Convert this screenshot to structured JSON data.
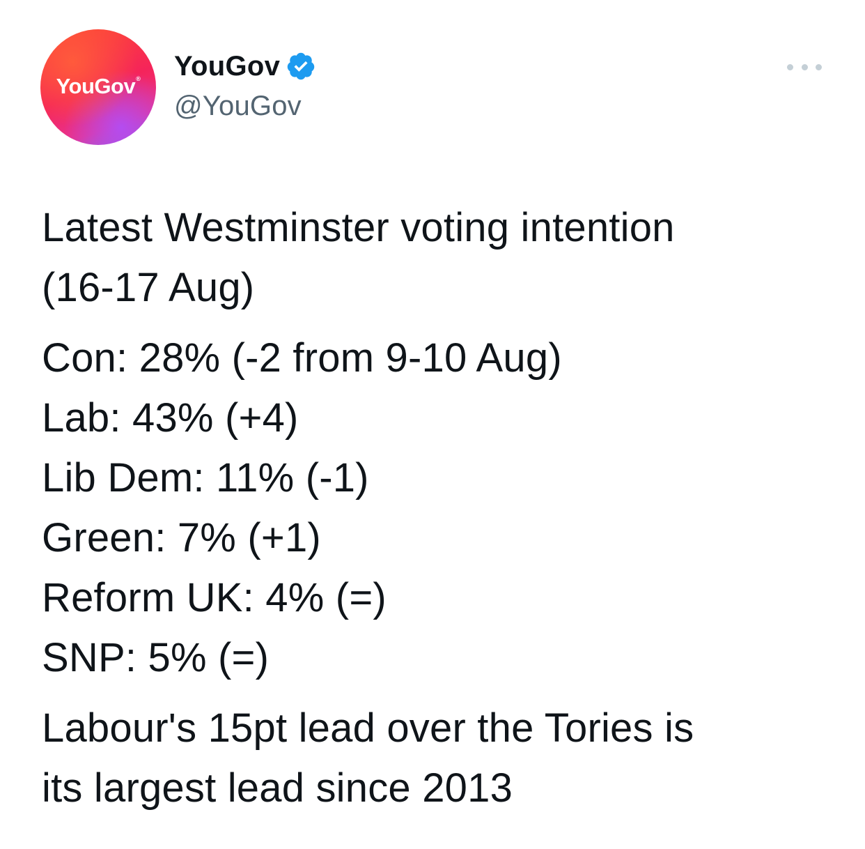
{
  "author": {
    "avatar_logo_text": "YouGov",
    "avatar_logo_mark": "®",
    "display_name": "YouGov",
    "verified_icon": "verified-badge-icon",
    "handle": "@YouGov"
  },
  "more_icon": "more-options-icon",
  "tweet": {
    "paragraphs": [
      {
        "lines": [
          "Latest Westminster voting intention",
          "(16-17 Aug)"
        ]
      },
      {
        "lines": [
          "Con: 28% (-2 from 9-10 Aug)",
          "Lab: 43% (+4)",
          "Lib Dem: 11% (-1)",
          "Green: 7% (+1)",
          "Reform UK: 4% (=)",
          "SNP: 5% (=)"
        ]
      },
      {
        "lines": [
          "Labour's 15pt lead over the Tories is",
          "its largest lead since 2013"
        ]
      }
    ]
  },
  "colors": {
    "text_primary": "#0f1419",
    "text_secondary": "#536471",
    "verified_blue": "#1d9bf0",
    "more_dots": "#c4cfd6"
  }
}
